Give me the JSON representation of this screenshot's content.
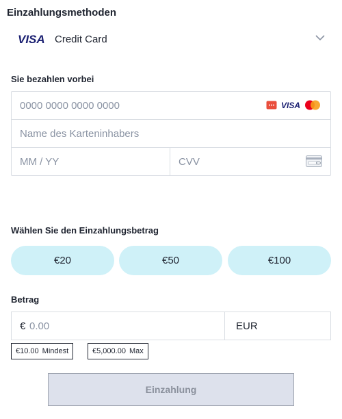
{
  "header": {
    "title": "Einzahlungsmethoden"
  },
  "method": {
    "logo_text": "VISA",
    "label": "Credit Card"
  },
  "card_form": {
    "title": "Sie bezahlen vorbei",
    "card_number_placeholder": "0000 0000 0000 0000",
    "card_holder_placeholder": "Name des Karteninhabers",
    "expiry_placeholder": "MM / YY",
    "cvv_placeholder": "CVV",
    "brand_visa": "VISA"
  },
  "amount_select": {
    "title": "Wählen Sie den Einzahlungsbetrag",
    "options": [
      "€20",
      "€50",
      "€100"
    ]
  },
  "amount": {
    "title": "Betrag",
    "currency_symbol": "€",
    "placeholder": "0.00",
    "currency": "EUR",
    "min_value": "€10.00",
    "min_label": "Mindest",
    "max_value": "€5,000.00",
    "max_label": "Max"
  },
  "submit": {
    "label": "Einzahlung"
  },
  "colors": {
    "amount_button_bg": "#cff1f8",
    "submit_bg": "#dde1ec",
    "visa_blue": "#1a1f71",
    "mastercard_red": "#eb001b",
    "mastercard_orange": "#f79e1b"
  }
}
